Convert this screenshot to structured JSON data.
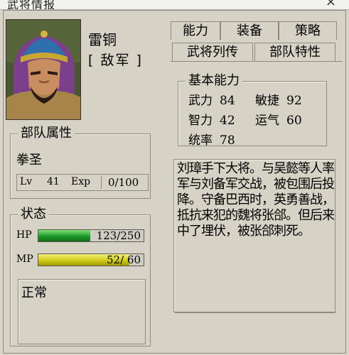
{
  "window": {
    "title": "武将情报",
    "close_glyph": "×"
  },
  "general": {
    "name": "雷铜",
    "faction": "[ 敌军 ]"
  },
  "tabs": {
    "row1": [
      "能力",
      "装备",
      "策略"
    ],
    "row2": [
      "武将列传",
      "部队特性"
    ],
    "active": "武将列传"
  },
  "troop": {
    "title": "部队属性",
    "type": "拳圣",
    "level_label": "Lv",
    "level": "41",
    "exp_label": "Exp",
    "exp": "0/100"
  },
  "status": {
    "title": "状态",
    "hp_label": "HP",
    "hp_text": "123/250",
    "hp_current": 123,
    "hp_max": 250,
    "mp_label": "MP",
    "mp_text": "52/ 60",
    "mp_current": 52,
    "mp_max": 60,
    "condition": "正常"
  },
  "abilities": {
    "title": "基本能力",
    "stats": [
      {
        "label": "武力",
        "value": "84"
      },
      {
        "label": "敏捷",
        "value": "92"
      },
      {
        "label": "智力",
        "value": "42"
      },
      {
        "label": "运气",
        "value": "60"
      },
      {
        "label": "统率",
        "value": "78"
      }
    ]
  },
  "biography": "刘璋手下大将。与吴懿等人率军与刘备军交战，被包围后投降。守备巴西时，英勇善战，抵抗来犯的魏将张郃。但后来中了埋伏，被张郃刺死。",
  "colors": {
    "hp_bar": "#1f9a2a",
    "mp_bar": "#d1cb1a",
    "panel": "#d6d2c6"
  }
}
